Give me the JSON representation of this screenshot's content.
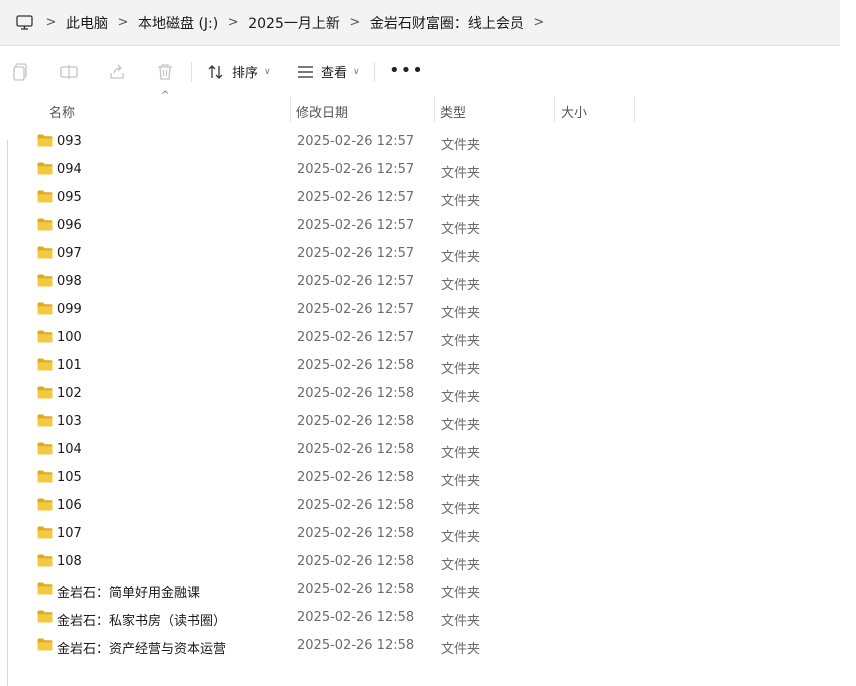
{
  "breadcrumb": [
    "此电脑",
    "本地磁盘 (J:)",
    "2025一月上新",
    "金岩石财富圈：线上会员"
  ],
  "toolbar": {
    "sort_label": "排序",
    "view_label": "查看",
    "more_label": "•••"
  },
  "columns": {
    "name": "名称",
    "date": "修改日期",
    "type": "类型",
    "size": "大小"
  },
  "files": [
    {
      "name": "093",
      "date": "2025-02-26 12:57",
      "type": "文件夹"
    },
    {
      "name": "094",
      "date": "2025-02-26 12:57",
      "type": "文件夹"
    },
    {
      "name": "095",
      "date": "2025-02-26 12:57",
      "type": "文件夹"
    },
    {
      "name": "096",
      "date": "2025-02-26 12:57",
      "type": "文件夹"
    },
    {
      "name": "097",
      "date": "2025-02-26 12:57",
      "type": "文件夹"
    },
    {
      "name": "098",
      "date": "2025-02-26 12:57",
      "type": "文件夹"
    },
    {
      "name": "099",
      "date": "2025-02-26 12:57",
      "type": "文件夹"
    },
    {
      "name": "100",
      "date": "2025-02-26 12:57",
      "type": "文件夹"
    },
    {
      "name": "101",
      "date": "2025-02-26 12:58",
      "type": "文件夹"
    },
    {
      "name": "102",
      "date": "2025-02-26 12:58",
      "type": "文件夹"
    },
    {
      "name": "103",
      "date": "2025-02-26 12:58",
      "type": "文件夹"
    },
    {
      "name": "104",
      "date": "2025-02-26 12:58",
      "type": "文件夹"
    },
    {
      "name": "105",
      "date": "2025-02-26 12:58",
      "type": "文件夹"
    },
    {
      "name": "106",
      "date": "2025-02-26 12:58",
      "type": "文件夹"
    },
    {
      "name": "107",
      "date": "2025-02-26 12:58",
      "type": "文件夹"
    },
    {
      "name": "108",
      "date": "2025-02-26 12:58",
      "type": "文件夹"
    },
    {
      "name": "金岩石：简单好用金融课",
      "date": "2025-02-26 12:58",
      "type": "文件夹"
    },
    {
      "name": "金岩石：私家书房（读书圈）",
      "date": "2025-02-26 12:58",
      "type": "文件夹"
    },
    {
      "name": "金岩石：资产经营与资本运营",
      "date": "2025-02-26 12:58",
      "type": "文件夹"
    }
  ],
  "colors": {
    "folder": "#f5c842",
    "folder_dark": "#e0a920",
    "muted_text": "#6b6b6b"
  }
}
